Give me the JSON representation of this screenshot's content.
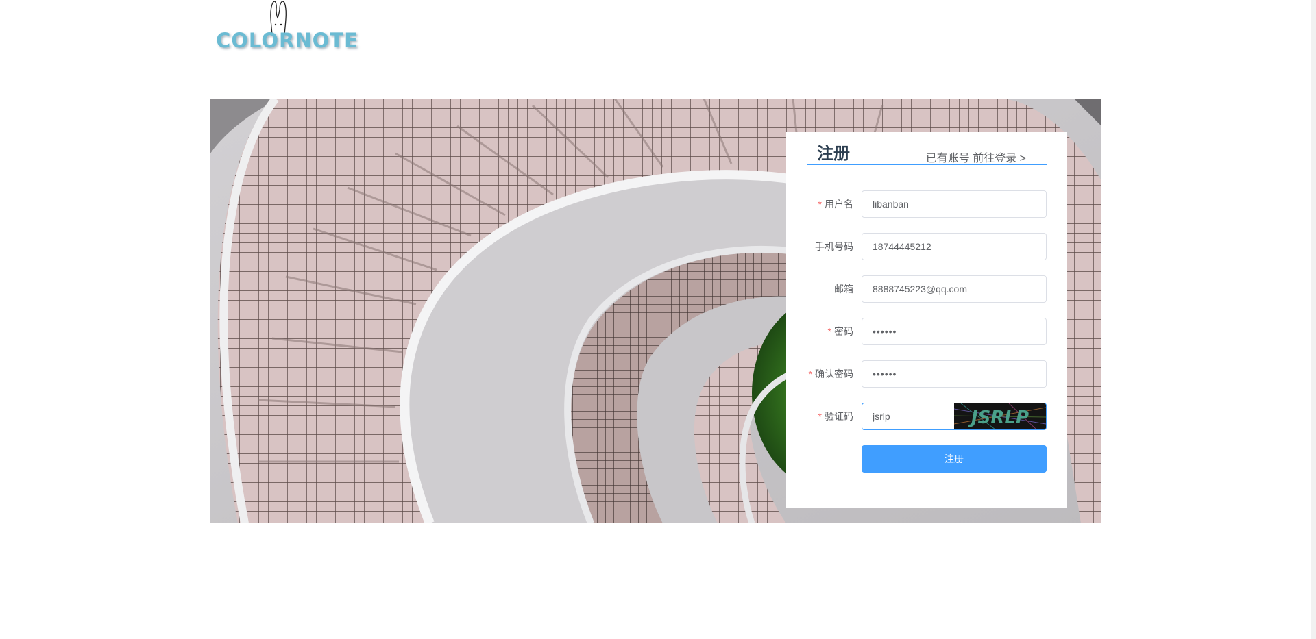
{
  "logo": {
    "text": "COLORNOTE",
    "icon": "rabbit-logo-icon"
  },
  "banner": {
    "image": "spiral-staircase-photo"
  },
  "register": {
    "title": "注册",
    "login_link": "已有账号 前往登录 >",
    "fields": {
      "username": {
        "label": "用户名",
        "required": true,
        "value": "libanban"
      },
      "phone": {
        "label": "手机号码",
        "required": false,
        "value": "18744445212"
      },
      "email": {
        "label": "邮箱",
        "required": false,
        "value": "8888745223@qq.com"
      },
      "password": {
        "label": "密码",
        "required": true,
        "value": "••••••"
      },
      "confirm_password": {
        "label": "确认密码",
        "required": true,
        "value": "••••••"
      },
      "captcha": {
        "label": "验证码",
        "required": true,
        "value": "jsrlp",
        "captcha_text": "JSRLP"
      }
    },
    "required_mark": "*",
    "submit_label": "注册"
  },
  "colors": {
    "primary": "#409eff",
    "logo": "#6bbbd3",
    "required": "#f56c6c",
    "label": "#606266"
  }
}
